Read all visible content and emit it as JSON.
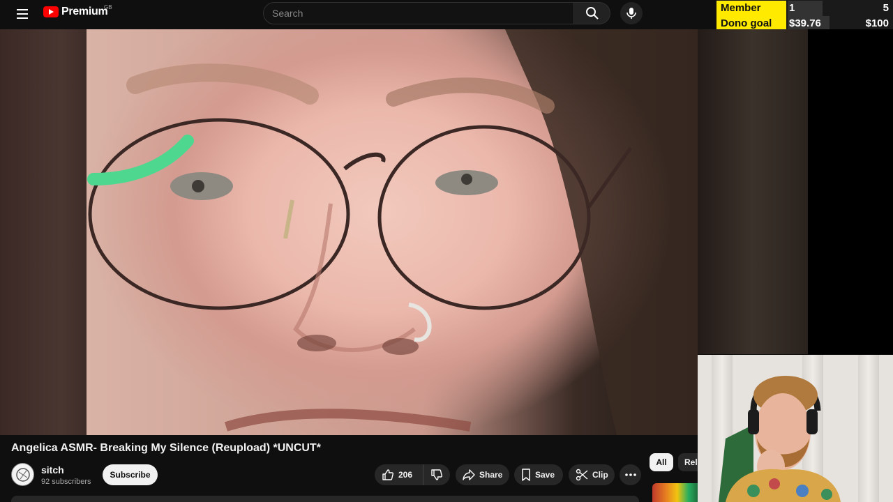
{
  "header": {
    "logo_text": "Premium",
    "region": "GB",
    "search_placeholder": "Search"
  },
  "goals": {
    "member_label": "Member Goal",
    "member_current": "1",
    "member_target": "5",
    "dono_label": "Dono goal",
    "dono_current": "$39.76",
    "dono_target": "$100",
    "accent": "#ffea00"
  },
  "video": {
    "title": "Angelica ASMR- Breaking My Silence (Reupload) *UNCUT*"
  },
  "channel": {
    "name": "sitch",
    "subscribers": "92 subscribers",
    "subscribe_label": "Subscribe"
  },
  "actions": {
    "like_count": "206",
    "share_label": "Share",
    "save_label": "Save",
    "clip_label": "Clip"
  },
  "chips": {
    "all": "All",
    "related": "Related"
  },
  "icons": [
    "menu-icon",
    "youtube-logo-icon",
    "search-icon",
    "mic-icon",
    "thumbs-up-icon",
    "thumbs-down-icon",
    "share-icon",
    "save-icon",
    "scissors-icon",
    "more-icon"
  ]
}
